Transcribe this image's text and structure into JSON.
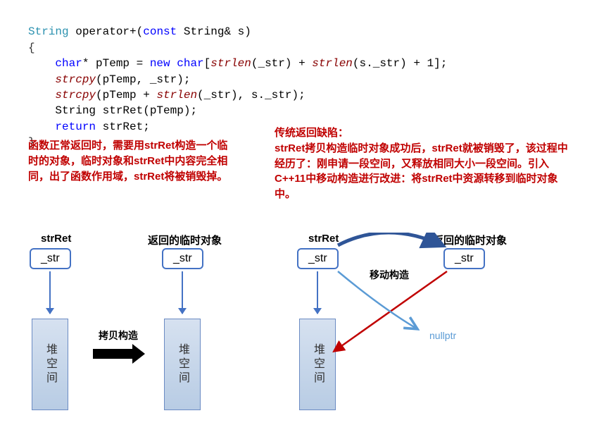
{
  "code": {
    "sig_ret": "String",
    "op": " operator+(",
    "const": "const",
    "sig_rest": " String& s)",
    "brace_open": "{",
    "l1_a": "char",
    "l1_b": "* pTemp = ",
    "l1_new": "new",
    "l1_c": " ",
    "l1_char": "char",
    "l1_d": "[",
    "strlen1": "strlen",
    "l1_e": "(_str) + ",
    "strlen2": "strlen",
    "l1_f": "(s._str) + 1];",
    "l2_a": "strcpy",
    "l2_b": "(pTemp, _str);",
    "l3_a": "strcpy",
    "l3_b": "(pTemp + ",
    "l3_c": "strlen",
    "l3_d": "(_str), s._str);",
    "l4_a": "String strRet(pTemp);",
    "l5_ret": "return",
    "l5_b": " strRet;",
    "brace_close": "}"
  },
  "annotations": {
    "left": "函数正常返回时，需要用strRet构造一个临时的对象，临时对象和strRet中内容完全相同，出了函数作用域，strRet将被销毁掉。",
    "right_title": "传统返回缺陷：",
    "right_body": "strRet拷贝构造临时对象成功后，strRet就被销毁了，该过程中经历了：刚申请一段空间，又释放相同大小一段空间。引入C++11中移动构造进行改进：将strRet中资源转移到临时对象中。"
  },
  "diagram": {
    "strRet": "strRet",
    "tempObj": "返回的临时对象",
    "strField": "_str",
    "heap": "堆空间",
    "copyCtor": "拷贝构造",
    "moveCtor": "移动构造",
    "nullptr": "nullptr"
  }
}
